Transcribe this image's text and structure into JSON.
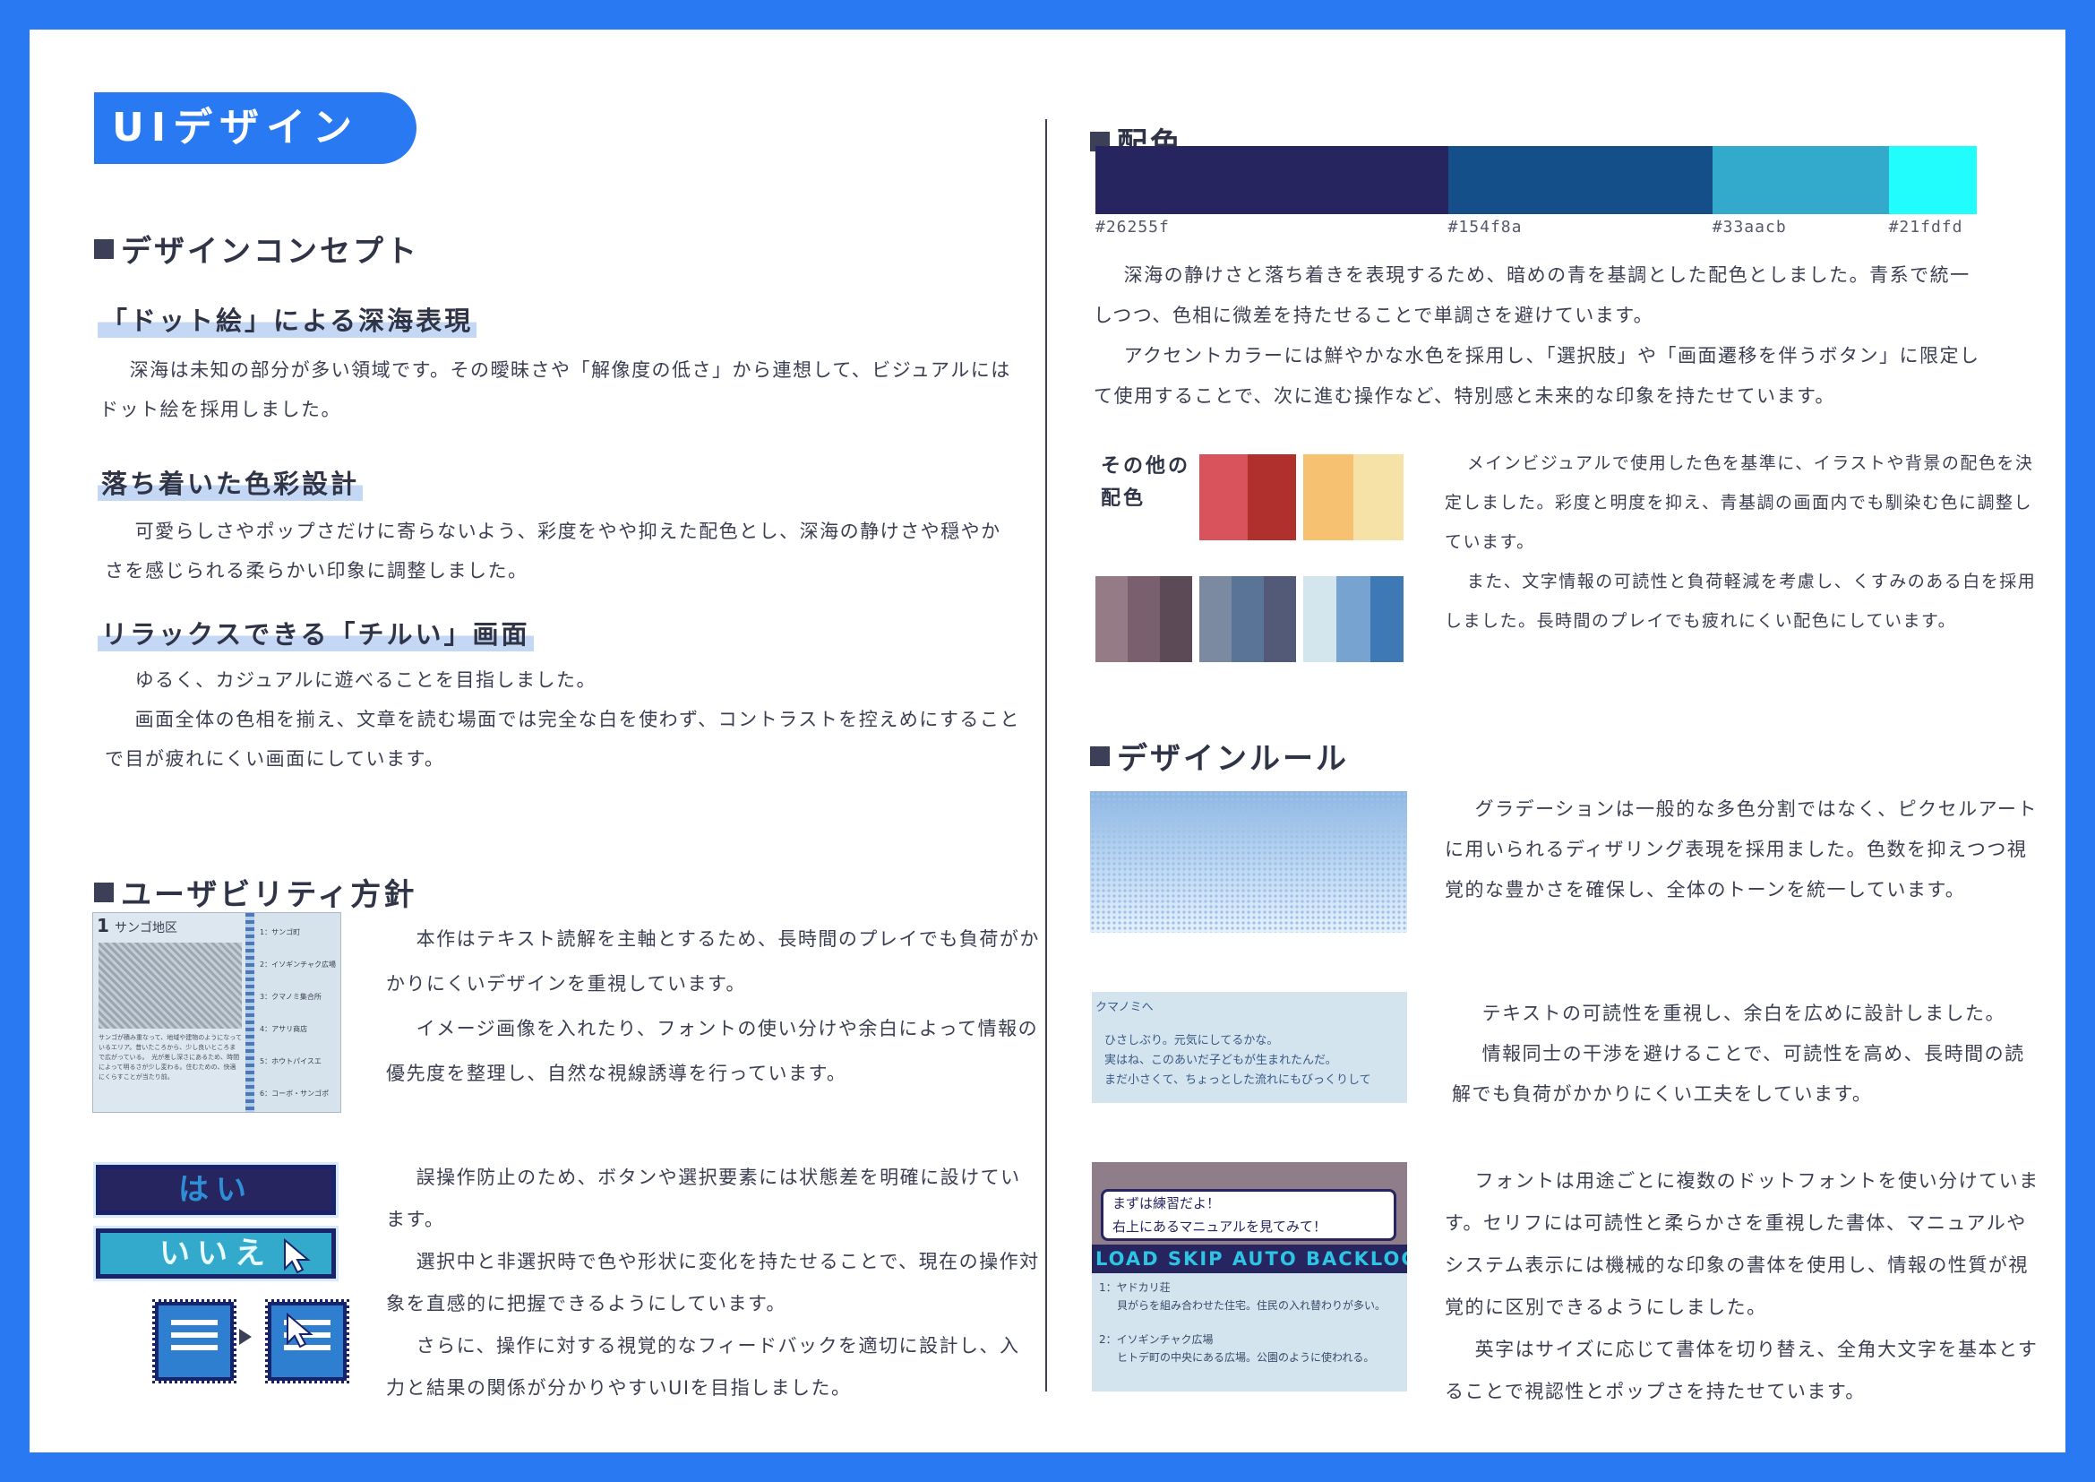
{
  "header": {
    "title": "UIデザイン"
  },
  "left": {
    "concept": {
      "heading": "デザインコンセプト",
      "items": [
        {
          "title": "「ドット絵」による深海表現",
          "text": [
            "深海は未知の部分が多い領域です。その曖昧さや「解像度の低さ」から連想して、ビジュアルにはドット絵を採用しました。"
          ]
        },
        {
          "title": "落ち着いた色彩設計",
          "text": [
            "可愛らしさやポップさだけに寄らないよう、彩度をやや抑えた配色とし、深海の静けさや穏やかさを感じられる柔らかい印象に調整しました。"
          ]
        },
        {
          "title": "リラックスできる「チルい」画面",
          "text": [
            "ゆるく、カジュアルに遊べることを目指しました。",
            "画面全体の色相を揃え、文章を読む場面では完全な白を使わず、コントラストを控えめにすることで目が疲れにくい画面にしています。"
          ]
        }
      ]
    },
    "usability": {
      "heading": "ユーザビリティ方針",
      "p1": [
        "本作はテキスト読解を主軸とするため、長時間のプレイでも負荷がかかりにくいデザインを重視しています。",
        "イメージ画像を入れたり、フォントの使い分けや余白によって情報の優先度を整理し、自然な視線誘導を行っています。"
      ],
      "p2": [
        "誤操作防止のため、ボタンや選択要素には状態差を明確に設けています。",
        "選択中と非選択時で色や形状に変化を持たせることで、現在の操作対象を直感的に把握できるようにしています。",
        "さらに、操作に対する視覚的なフィードバックを適切に設計し、入力と結果の関係が分かりやすいUIを目指しました。"
      ],
      "book": {
        "number": "1",
        "area": "サンゴ地区",
        "caption": "サンゴが積み重なって、地域や建物のようになっているエリア。昔いたころから、少し良いところまで広がっている。　光が差し深さにあるため、時間によって明るさが少し変わる。住むための、快適にくらすことが当たり前。",
        "list": [
          "1：サンゴ町",
          "2：イソギンチャク広場",
          "3：クマノミ集合所",
          "4：アサリ商店",
          "5：ホウトパイスエ",
          "6：コーボ・サンゴポ"
        ]
      },
      "buttons": {
        "yes": "はい",
        "no": "いいえ"
      }
    }
  },
  "right": {
    "color": {
      "heading": "配色",
      "swatches": [
        {
          "hex": "#26255f",
          "label": "#26255f",
          "weight": 0.4
        },
        {
          "hex": "#154f8a",
          "label": "#154f8a",
          "weight": 0.3
        },
        {
          "hex": "#33aacb",
          "label": "#33aacb",
          "weight": 0.2
        },
        {
          "hex": "#21fdfd",
          "label": "#21fdfd",
          "weight": 0.1
        }
      ],
      "text": [
        "深海の静けさと落ち着きを表現するため、暗めの青を基調とした配色としました。青系で統一しつつ、色相に微差を持たせることで単調さを避けています。",
        "アクセントカラーには鮮やかな水色を採用し、「選択肢」や「画面遷移を伴うボタン」に限定して使用することで、次に進む操作など、特別感と未来的な印象を持たせています。"
      ],
      "other_label_1": "その他の",
      "other_label_2": "配色",
      "other_text": [
        "メインビジュアルで使用した色を基準に、イラストや背景の配色を決定しました。彩度と明度を抑え、青基調の画面内でも馴染む色に調整しています。",
        "また、文字情報の可読性と負荷軽減を考慮し、くすみのある白を採用しました。長時間のプレイでも疲れにくい配色にしています。"
      ],
      "palettes": [
        [
          "#d9535c",
          "#b0302e"
        ],
        [
          "#f6c271",
          "#f6e2a6"
        ],
        [
          "#957b86",
          "#7a5f6e",
          "#5c4a56"
        ],
        [
          "#7c8aa1",
          "#5a7498",
          "#535a78"
        ],
        [
          "#d3e6ee",
          "#76a3d0",
          "#3e79b5"
        ]
      ]
    },
    "rules": {
      "heading": "デザインルール",
      "r1": [
        "グラデーションは一般的な多色分割ではなく、ピクセルアートに用いられるディザリング表現を採用ました。色数を抑えつつ視覚的な豊かさを確保し、全体のトーンを統一しています。"
      ],
      "r2": [
        "テキストの可読性を重視し、余白を広めに設計しました。",
        "情報同士の干渉を避けることで、可読性を高め、長時間の読解でも負荷がかかりにくい工夫をしています。"
      ],
      "r3": [
        "フォントは用途ごとに複数のドットフォントを使い分けています。セリフには可読性と柔らかさを重視した書体、マニュアルやシステム表示には機械的な印象の書体を使用し、情報の性質が視覚的に区別できるようにしました。",
        "英字はサイズに応じて書体を切り替え、全角大文字を基本とすることで視認性とポップさを持たせています。"
      ],
      "letter": {
        "to": "クマノミへ",
        "lines": [
          "ひさしぶり。元気にしてるかな。",
          "実はね、このあいだ子どもが生まれたんだ。",
          "まだ小さくて、ちょっとした流れにもびっくりして"
        ]
      },
      "game": {
        "bubble1": "まずは練習だよ！",
        "bubble2": "右上にあるマニュアルを見てみて！",
        "menu": "LOAD SKIP AUTO BACKLOG",
        "items": [
          {
            "t": "1：ヤドカリ荘",
            "d": "貝がらを組み合わせた住宅。住民の入れ替わりが多い。"
          },
          {
            "t": "2：イソギンチャク広場",
            "d": "ヒトデ町の中央にある広場。公園のように使われる。"
          }
        ]
      }
    }
  }
}
